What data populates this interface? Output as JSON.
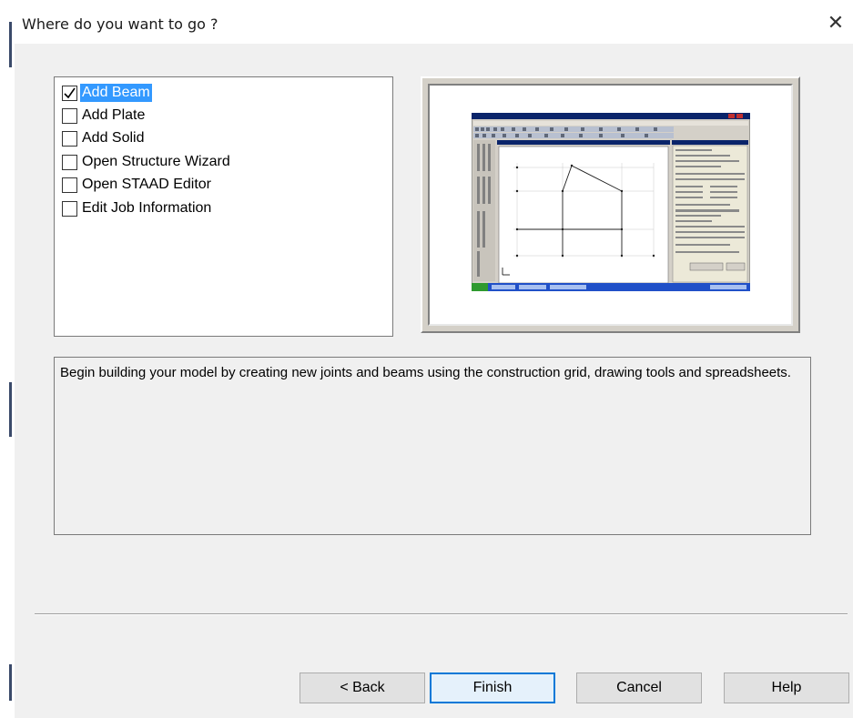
{
  "window": {
    "title": "Where do you want to go ?",
    "close_icon": "close-icon"
  },
  "options": [
    {
      "label": "Add Beam",
      "checked": true,
      "selected": true
    },
    {
      "label": "Add Plate",
      "checked": false,
      "selected": false
    },
    {
      "label": "Add Solid",
      "checked": false,
      "selected": false
    },
    {
      "label": "Open Structure Wizard",
      "checked": false,
      "selected": false
    },
    {
      "label": "Open STAAD Editor",
      "checked": false,
      "selected": false
    },
    {
      "label": "Edit Job Information",
      "checked": false,
      "selected": false
    }
  ],
  "description": "Begin building your model by creating new joints and beams using the construction grid, drawing tools and spreadsheets.",
  "buttons": {
    "back": "< Back",
    "finish": "Finish",
    "cancel": "Cancel",
    "help": "Help"
  },
  "colors": {
    "selection": "#3399ff",
    "default_button_border": "#0078d7",
    "thumbnail_titlebar": "#0a246a",
    "thumbnail_taskbar": "#2050c8"
  }
}
